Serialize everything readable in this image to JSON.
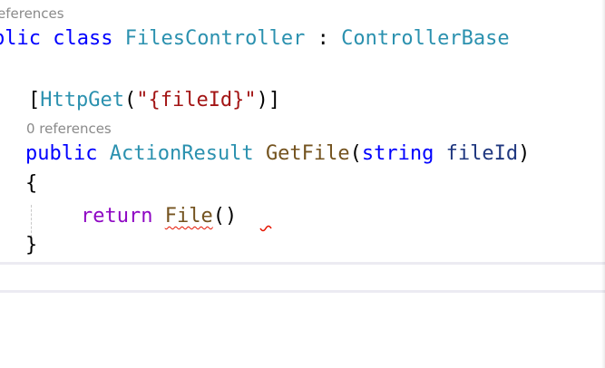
{
  "codelens": {
    "top": "eferences",
    "method": "0 references"
  },
  "code": {
    "class_decl": {
      "modifier_fragment": "blic",
      "class_kw": "class",
      "class_name": "FilesController",
      "colon": ":",
      "base": "ControllerBase"
    },
    "attribute": {
      "open_bracket": "[",
      "name": "HttpGet",
      "open_paren": "(",
      "route": "\"{fileId}\"",
      "close": ")]"
    },
    "method_decl": {
      "modifier": "public",
      "return_type": "ActionResult",
      "name": "GetFile",
      "open_paren": "(",
      "param_type": "string",
      "param_name": "fileId",
      "close_paren": ")"
    },
    "open_brace": "{",
    "return_stmt": {
      "keyword": "return",
      "call": "File",
      "parens": "()"
    },
    "close_brace": "}"
  },
  "colors": {
    "keyword": "#0000ff",
    "control_keyword": "#8f08c4",
    "type": "#2b91af",
    "method": "#74531f",
    "string": "#a31515",
    "parameter": "#1f377f",
    "codelens": "#8a8a8a",
    "error_squiggle": "#e51400"
  }
}
